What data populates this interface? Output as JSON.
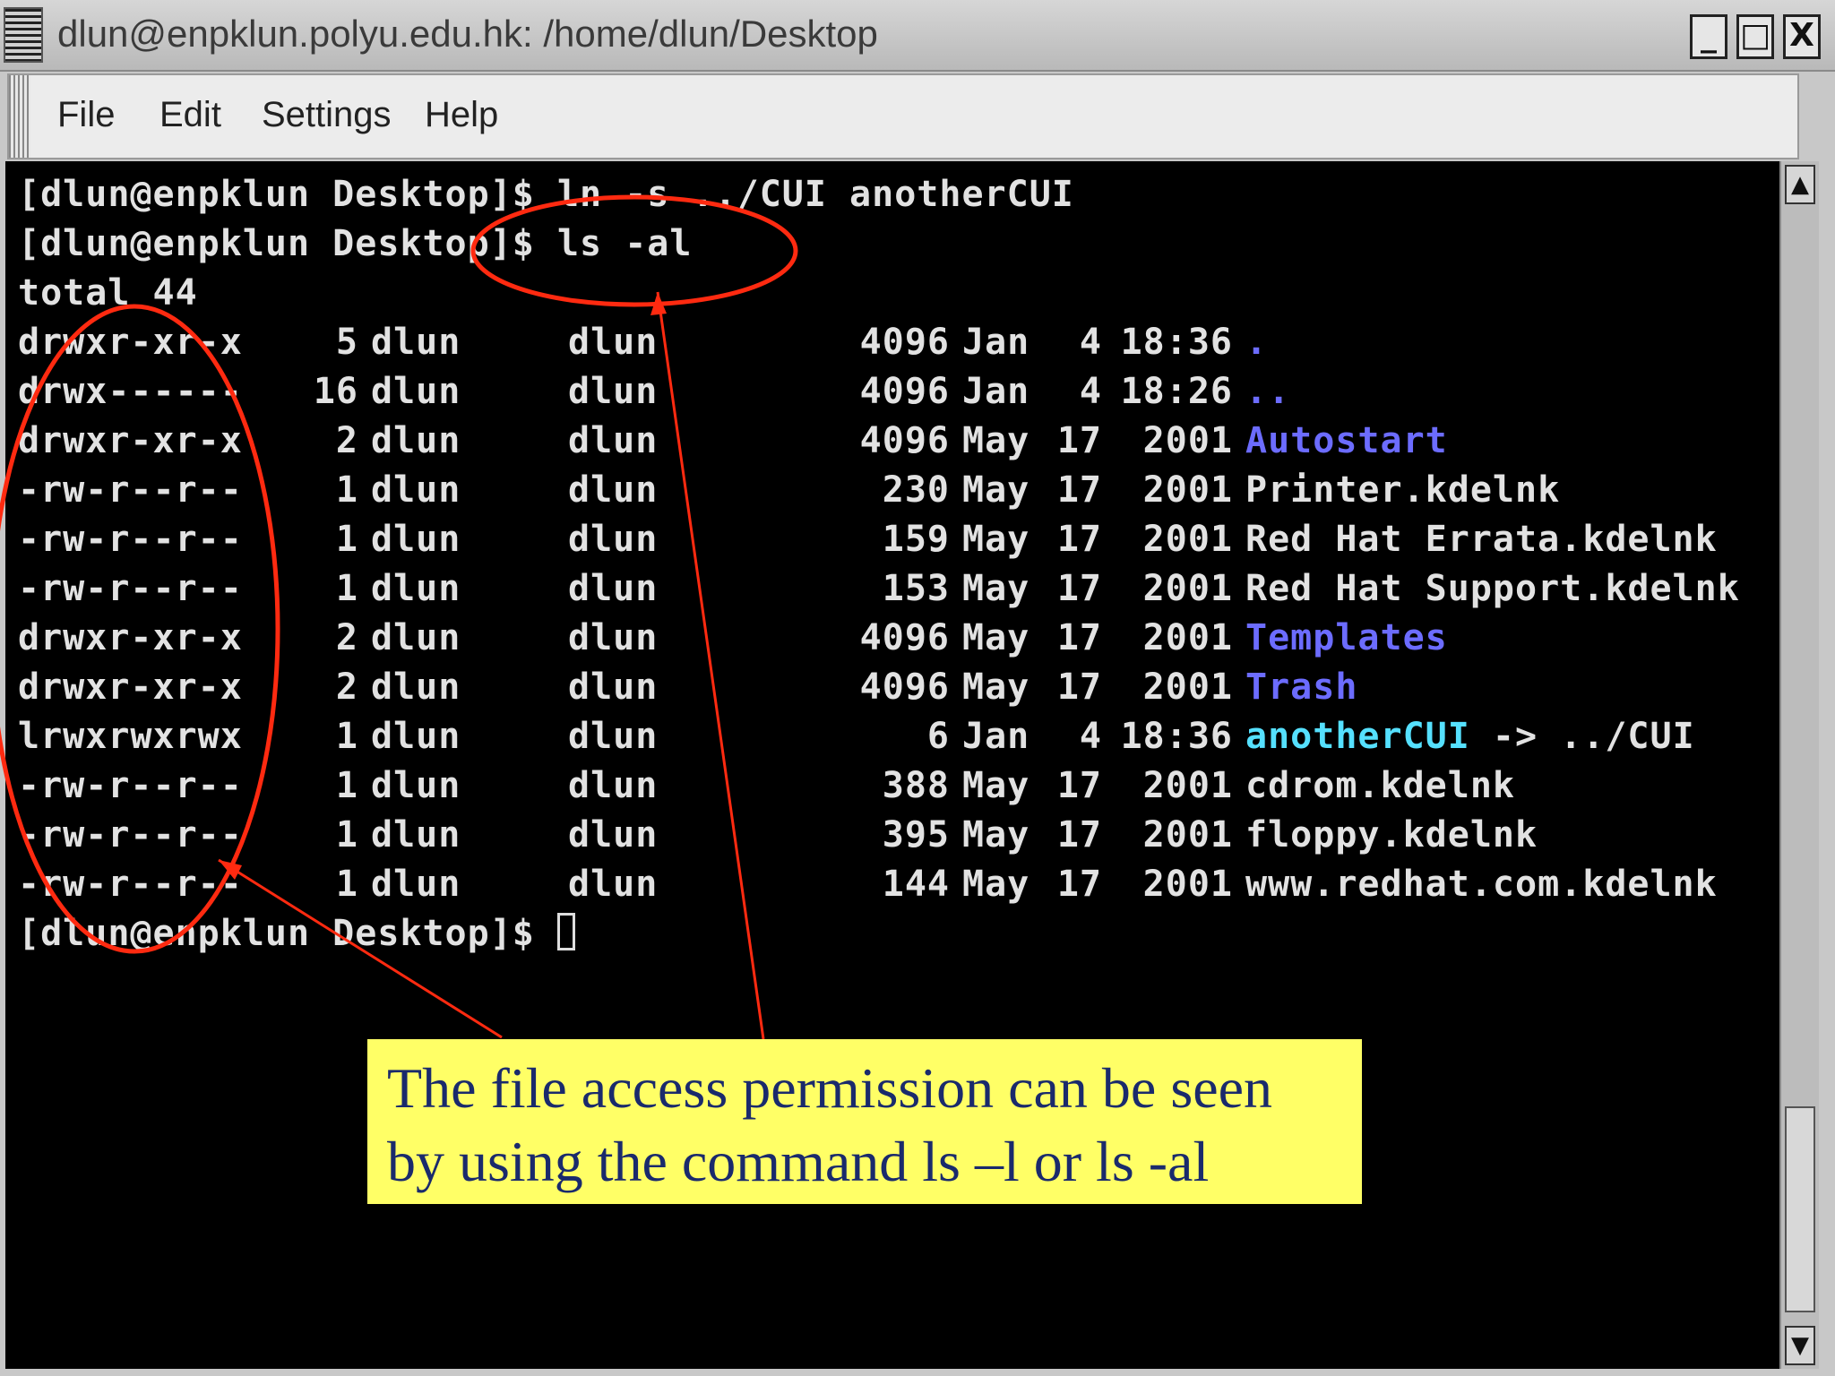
{
  "window": {
    "title": "dlun@enpklun.polyu.edu.hk: /home/dlun/Desktop",
    "buttons": {
      "minimize": "_",
      "maximize": "□",
      "close": "X"
    }
  },
  "menubar": {
    "items": [
      {
        "label": "File"
      },
      {
        "label": "Edit"
      },
      {
        "label": "Settings"
      },
      {
        "label": "Help"
      }
    ]
  },
  "terminal": {
    "cmd1": "[dlun@enpklun Desktop]$ ln -s ../CUI anotherCUI",
    "cmd2": "[dlun@enpklun Desktop]$ ls -al",
    "total": "total 44",
    "entries": [
      {
        "perm": "drwxr-xr-x",
        "links": "5",
        "owner": "dlun",
        "group": "dlun",
        "size": "4096",
        "month": "Jan",
        "day": "4",
        "time": "18:36",
        "name": ".",
        "kind": "dir",
        "target": ""
      },
      {
        "perm": "drwx------",
        "links": "16",
        "owner": "dlun",
        "group": "dlun",
        "size": "4096",
        "month": "Jan",
        "day": "4",
        "time": "18:26",
        "name": "..",
        "kind": "dir",
        "target": ""
      },
      {
        "perm": "drwxr-xr-x",
        "links": "2",
        "owner": "dlun",
        "group": "dlun",
        "size": "4096",
        "month": "May",
        "day": "17",
        "time": "2001",
        "name": "Autostart",
        "kind": "dir",
        "target": ""
      },
      {
        "perm": "-rw-r--r--",
        "links": "1",
        "owner": "dlun",
        "group": "dlun",
        "size": "230",
        "month": "May",
        "day": "17",
        "time": "2001",
        "name": "Printer.kdelnk",
        "kind": "file",
        "target": ""
      },
      {
        "perm": "-rw-r--r--",
        "links": "1",
        "owner": "dlun",
        "group": "dlun",
        "size": "159",
        "month": "May",
        "day": "17",
        "time": "2001",
        "name": "Red Hat Errata.kdelnk",
        "kind": "file",
        "target": ""
      },
      {
        "perm": "-rw-r--r--",
        "links": "1",
        "owner": "dlun",
        "group": "dlun",
        "size": "153",
        "month": "May",
        "day": "17",
        "time": "2001",
        "name": "Red Hat Support.kdelnk",
        "kind": "file",
        "target": ""
      },
      {
        "perm": "drwxr-xr-x",
        "links": "2",
        "owner": "dlun",
        "group": "dlun",
        "size": "4096",
        "month": "May",
        "day": "17",
        "time": "2001",
        "name": "Templates",
        "kind": "dir",
        "target": ""
      },
      {
        "perm": "drwxr-xr-x",
        "links": "2",
        "owner": "dlun",
        "group": "dlun",
        "size": "4096",
        "month": "May",
        "day": "17",
        "time": "2001",
        "name": "Trash",
        "kind": "dir",
        "target": ""
      },
      {
        "perm": "lrwxrwxrwx",
        "links": "1",
        "owner": "dlun",
        "group": "dlun",
        "size": "6",
        "month": "Jan",
        "day": "4",
        "time": "18:36",
        "name": "anotherCUI",
        "kind": "link",
        "target": " -> ../CUI"
      },
      {
        "perm": "-rw-r--r--",
        "links": "1",
        "owner": "dlun",
        "group": "dlun",
        "size": "388",
        "month": "May",
        "day": "17",
        "time": "2001",
        "name": "cdrom.kdelnk",
        "kind": "file",
        "target": ""
      },
      {
        "perm": "-rw-r--r--",
        "links": "1",
        "owner": "dlun",
        "group": "dlun",
        "size": "395",
        "month": "May",
        "day": "17",
        "time": "2001",
        "name": "floppy.kdelnk",
        "kind": "file",
        "target": ""
      },
      {
        "perm": "-rw-r--r--",
        "links": "1",
        "owner": "dlun",
        "group": "dlun",
        "size": "144",
        "month": "May",
        "day": "17",
        "time": "2001",
        "name": "www.redhat.com.kdelnk",
        "kind": "file",
        "target": ""
      }
    ],
    "prompt": "[dlun@enpklun Desktop]$ "
  },
  "annotation": {
    "line1": "The file access permission can be seen",
    "line2": "by using the command ls –l or ls -al"
  },
  "colors": {
    "directory": "#6c6cff",
    "symlink": "#55e0ff",
    "annotation_stroke": "#ff2a10",
    "callout_bg": "#ffff66",
    "callout_text": "#1a2a6c"
  }
}
